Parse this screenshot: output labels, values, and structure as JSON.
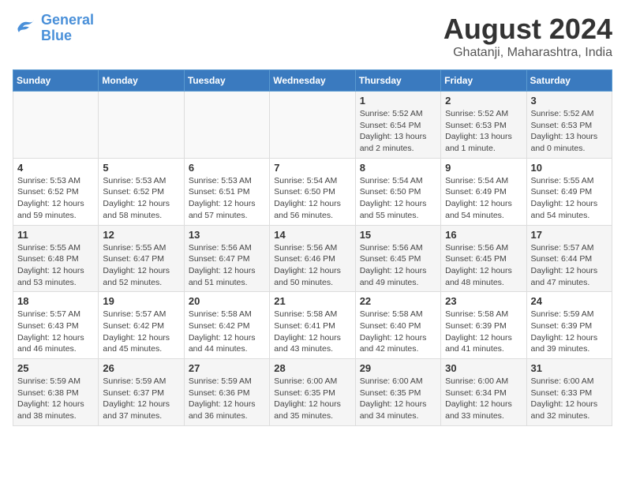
{
  "logo": {
    "line1": "General",
    "line2": "Blue"
  },
  "title": "August 2024",
  "subtitle": "Ghatanji, Maharashtra, India",
  "days_of_week": [
    "Sunday",
    "Monday",
    "Tuesday",
    "Wednesday",
    "Thursday",
    "Friday",
    "Saturday"
  ],
  "weeks": [
    [
      {
        "day": "",
        "info": ""
      },
      {
        "day": "",
        "info": ""
      },
      {
        "day": "",
        "info": ""
      },
      {
        "day": "",
        "info": ""
      },
      {
        "day": "1",
        "info": "Sunrise: 5:52 AM\nSunset: 6:54 PM\nDaylight: 13 hours\nand 2 minutes."
      },
      {
        "day": "2",
        "info": "Sunrise: 5:52 AM\nSunset: 6:53 PM\nDaylight: 13 hours\nand 1 minute."
      },
      {
        "day": "3",
        "info": "Sunrise: 5:52 AM\nSunset: 6:53 PM\nDaylight: 13 hours\nand 0 minutes."
      }
    ],
    [
      {
        "day": "4",
        "info": "Sunrise: 5:53 AM\nSunset: 6:52 PM\nDaylight: 12 hours\nand 59 minutes."
      },
      {
        "day": "5",
        "info": "Sunrise: 5:53 AM\nSunset: 6:52 PM\nDaylight: 12 hours\nand 58 minutes."
      },
      {
        "day": "6",
        "info": "Sunrise: 5:53 AM\nSunset: 6:51 PM\nDaylight: 12 hours\nand 57 minutes."
      },
      {
        "day": "7",
        "info": "Sunrise: 5:54 AM\nSunset: 6:50 PM\nDaylight: 12 hours\nand 56 minutes."
      },
      {
        "day": "8",
        "info": "Sunrise: 5:54 AM\nSunset: 6:50 PM\nDaylight: 12 hours\nand 55 minutes."
      },
      {
        "day": "9",
        "info": "Sunrise: 5:54 AM\nSunset: 6:49 PM\nDaylight: 12 hours\nand 54 minutes."
      },
      {
        "day": "10",
        "info": "Sunrise: 5:55 AM\nSunset: 6:49 PM\nDaylight: 12 hours\nand 54 minutes."
      }
    ],
    [
      {
        "day": "11",
        "info": "Sunrise: 5:55 AM\nSunset: 6:48 PM\nDaylight: 12 hours\nand 53 minutes."
      },
      {
        "day": "12",
        "info": "Sunrise: 5:55 AM\nSunset: 6:47 PM\nDaylight: 12 hours\nand 52 minutes."
      },
      {
        "day": "13",
        "info": "Sunrise: 5:56 AM\nSunset: 6:47 PM\nDaylight: 12 hours\nand 51 minutes."
      },
      {
        "day": "14",
        "info": "Sunrise: 5:56 AM\nSunset: 6:46 PM\nDaylight: 12 hours\nand 50 minutes."
      },
      {
        "day": "15",
        "info": "Sunrise: 5:56 AM\nSunset: 6:45 PM\nDaylight: 12 hours\nand 49 minutes."
      },
      {
        "day": "16",
        "info": "Sunrise: 5:56 AM\nSunset: 6:45 PM\nDaylight: 12 hours\nand 48 minutes."
      },
      {
        "day": "17",
        "info": "Sunrise: 5:57 AM\nSunset: 6:44 PM\nDaylight: 12 hours\nand 47 minutes."
      }
    ],
    [
      {
        "day": "18",
        "info": "Sunrise: 5:57 AM\nSunset: 6:43 PM\nDaylight: 12 hours\nand 46 minutes."
      },
      {
        "day": "19",
        "info": "Sunrise: 5:57 AM\nSunset: 6:42 PM\nDaylight: 12 hours\nand 45 minutes."
      },
      {
        "day": "20",
        "info": "Sunrise: 5:58 AM\nSunset: 6:42 PM\nDaylight: 12 hours\nand 44 minutes."
      },
      {
        "day": "21",
        "info": "Sunrise: 5:58 AM\nSunset: 6:41 PM\nDaylight: 12 hours\nand 43 minutes."
      },
      {
        "day": "22",
        "info": "Sunrise: 5:58 AM\nSunset: 6:40 PM\nDaylight: 12 hours\nand 42 minutes."
      },
      {
        "day": "23",
        "info": "Sunrise: 5:58 AM\nSunset: 6:39 PM\nDaylight: 12 hours\nand 41 minutes."
      },
      {
        "day": "24",
        "info": "Sunrise: 5:59 AM\nSunset: 6:39 PM\nDaylight: 12 hours\nand 39 minutes."
      }
    ],
    [
      {
        "day": "25",
        "info": "Sunrise: 5:59 AM\nSunset: 6:38 PM\nDaylight: 12 hours\nand 38 minutes."
      },
      {
        "day": "26",
        "info": "Sunrise: 5:59 AM\nSunset: 6:37 PM\nDaylight: 12 hours\nand 37 minutes."
      },
      {
        "day": "27",
        "info": "Sunrise: 5:59 AM\nSunset: 6:36 PM\nDaylight: 12 hours\nand 36 minutes."
      },
      {
        "day": "28",
        "info": "Sunrise: 6:00 AM\nSunset: 6:35 PM\nDaylight: 12 hours\nand 35 minutes."
      },
      {
        "day": "29",
        "info": "Sunrise: 6:00 AM\nSunset: 6:35 PM\nDaylight: 12 hours\nand 34 minutes."
      },
      {
        "day": "30",
        "info": "Sunrise: 6:00 AM\nSunset: 6:34 PM\nDaylight: 12 hours\nand 33 minutes."
      },
      {
        "day": "31",
        "info": "Sunrise: 6:00 AM\nSunset: 6:33 PM\nDaylight: 12 hours\nand 32 minutes."
      }
    ]
  ]
}
